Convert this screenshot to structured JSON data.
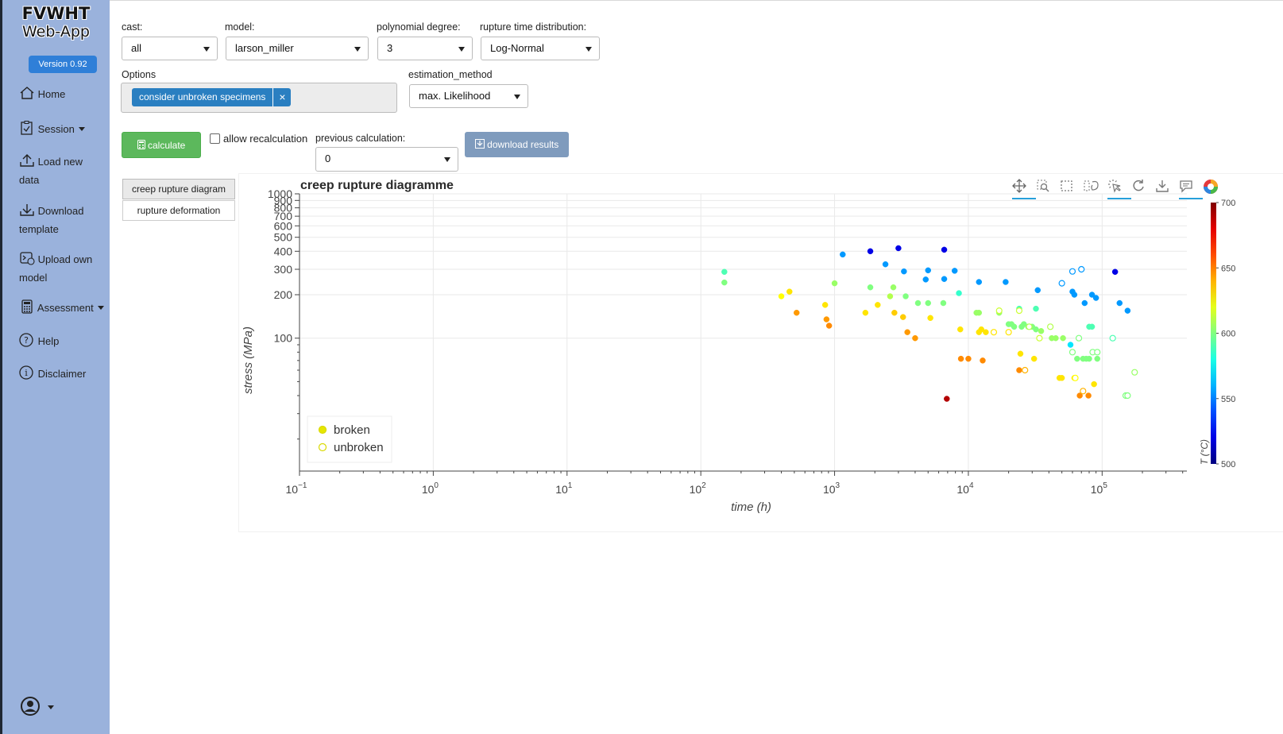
{
  "app": {
    "title": "FVWHT",
    "subtitle": "Web-App",
    "version": "Version 0.92"
  },
  "sidebar": {
    "items": [
      {
        "label": "Home",
        "icon": "home-icon"
      },
      {
        "label": "Session",
        "icon": "clipboard-check-icon",
        "dropdown": true
      },
      {
        "label": "Load new data",
        "icon": "upload-icon"
      },
      {
        "label": "Download template",
        "icon": "download-icon"
      },
      {
        "label": "Upload own model",
        "icon": "terminal-upload-icon"
      },
      {
        "label": "Assessment",
        "icon": "calculator-icon",
        "dropdown": true
      },
      {
        "label": "Help",
        "icon": "question-circle-icon"
      },
      {
        "label": "Disclaimer",
        "icon": "info-circle-icon"
      }
    ],
    "user_icon": "user-circle-icon"
  },
  "controls": {
    "cast_label": "cast:",
    "cast_value": "all",
    "model_label": "model:",
    "model_value": "larson_miller",
    "degree_label": "polynomial degree:",
    "degree_value": "3",
    "distribution_label": "rupture time distribution:",
    "distribution_value": "Log-Normal",
    "options_label": "Options",
    "options_chip": "consider unbroken specimens",
    "chip_remove": "×",
    "estimation_label": "estimation_method",
    "estimation_value": "max. Likelihood",
    "calculate_label": "calculate",
    "recalc_label": "allow recalculation",
    "previous_label": "previous calculation:",
    "previous_value": "0",
    "download_label": "download results"
  },
  "tabs": [
    {
      "label": "creep rupture diagram",
      "active": true
    },
    {
      "label": "rupture deformation",
      "active": false
    }
  ],
  "toolbar_icons": [
    "pan-icon",
    "box-zoom-icon",
    "box-select-icon",
    "lasso-select-icon",
    "tap-icon",
    "reset-icon",
    "save-icon",
    "hover-icon",
    "bokeh-logo-icon"
  ],
  "chart_data": {
    "type": "scatter",
    "title": "creep rupture diagramme",
    "xlabel": "time (h)",
    "ylabel": "stress (MPa)",
    "xscale": "log",
    "yscale": "log",
    "xlim": [
      0.1,
      430000
    ],
    "ylim": [
      12,
      1000
    ],
    "xticks": [
      0.1,
      1,
      10,
      100,
      1000,
      10000,
      100000
    ],
    "xtick_labels": [
      [
        "10",
        "−1"
      ],
      [
        "10",
        "0"
      ],
      [
        "10",
        "1"
      ],
      [
        "10",
        "2"
      ],
      [
        "10",
        "3"
      ],
      [
        "10",
        "4"
      ],
      [
        "10",
        "5"
      ]
    ],
    "yticks": [
      100,
      200,
      300,
      400,
      500,
      600,
      700,
      800,
      900,
      1000
    ],
    "ytick_labels": [
      "100",
      "200",
      "300",
      "400",
      "500",
      "600",
      "700",
      "800",
      "900",
      "1000"
    ],
    "grid": true,
    "legend": [
      {
        "label": "broken",
        "marker": "filled-circle"
      },
      {
        "label": "unbroken",
        "marker": "open-circle"
      }
    ],
    "legend_position": "bottom-left",
    "colorbar": {
      "label": "T (°C)",
      "min": 500,
      "max": 700,
      "ticks": [
        700,
        650,
        600,
        550,
        500
      ],
      "colormap": "jet"
    },
    "series": [
      {
        "name": "broken",
        "points": [
          [
            150,
            288,
            590
          ],
          [
            150,
            243,
            600
          ],
          [
            400,
            195,
            625
          ],
          [
            460,
            210,
            630
          ],
          [
            520,
            150,
            645
          ],
          [
            850,
            170,
            630
          ],
          [
            870,
            135,
            645
          ],
          [
            910,
            122,
            648
          ],
          [
            1000,
            240,
            605
          ],
          [
            1150,
            380,
            555
          ],
          [
            1700,
            150,
            630
          ],
          [
            1850,
            225,
            600
          ],
          [
            1850,
            400,
            520
          ],
          [
            2100,
            170,
            630
          ],
          [
            2400,
            325,
            555
          ],
          [
            2600,
            195,
            610
          ],
          [
            2750,
            225,
            605
          ],
          [
            2800,
            150,
            635
          ],
          [
            3000,
            420,
            520
          ],
          [
            3250,
            140,
            635
          ],
          [
            3300,
            290,
            555
          ],
          [
            3400,
            195,
            600
          ],
          [
            3500,
            110,
            645
          ],
          [
            4000,
            100,
            645
          ],
          [
            4200,
            175,
            600
          ],
          [
            4800,
            255,
            555
          ],
          [
            5000,
            175,
            600
          ],
          [
            5000,
            295,
            555
          ],
          [
            5200,
            138,
            630
          ],
          [
            6500,
            175,
            600
          ],
          [
            6600,
            257,
            555
          ],
          [
            6600,
            410,
            520
          ],
          [
            6900,
            38,
            690
          ],
          [
            7900,
            293,
            555
          ],
          [
            8500,
            205,
            585
          ],
          [
            8700,
            115,
            630
          ],
          [
            8800,
            72,
            648
          ],
          [
            10000,
            72,
            648
          ],
          [
            11500,
            150,
            605
          ],
          [
            12000,
            150,
            605
          ],
          [
            12000,
            245,
            555
          ],
          [
            12000,
            110,
            630
          ],
          [
            12500,
            115,
            630
          ],
          [
            12800,
            70,
            648
          ],
          [
            13500,
            110,
            630
          ],
          [
            17000,
            150,
            605
          ],
          [
            19000,
            245,
            555
          ],
          [
            20000,
            125,
            600
          ],
          [
            21000,
            125,
            600
          ],
          [
            22000,
            120,
            600
          ],
          [
            24000,
            160,
            590
          ],
          [
            24000,
            60,
            648
          ],
          [
            24500,
            78,
            630
          ],
          [
            25000,
            120,
            600
          ],
          [
            26000,
            125,
            600
          ],
          [
            28000,
            120,
            600
          ],
          [
            30000,
            120,
            600
          ],
          [
            31000,
            72,
            630
          ],
          [
            32000,
            160,
            590
          ],
          [
            32000,
            115,
            600
          ],
          [
            33000,
            215,
            555
          ],
          [
            35000,
            112,
            605
          ],
          [
            42000,
            100,
            605
          ],
          [
            45000,
            100,
            605
          ],
          [
            48000,
            53,
            630
          ],
          [
            50000,
            53,
            630
          ],
          [
            51000,
            100,
            605
          ],
          [
            58000,
            90,
            570
          ],
          [
            60000,
            210,
            555
          ],
          [
            62000,
            200,
            555
          ],
          [
            62000,
            53,
            630
          ],
          [
            65000,
            72,
            600
          ],
          [
            68000,
            40,
            648
          ],
          [
            72000,
            72,
            600
          ],
          [
            74000,
            175,
            555
          ],
          [
            76000,
            72,
            600
          ],
          [
            79000,
            40,
            648
          ],
          [
            80000,
            72,
            600
          ],
          [
            80000,
            120,
            590
          ],
          [
            84000,
            120,
            590
          ],
          [
            84000,
            200,
            555
          ],
          [
            87000,
            48,
            630
          ],
          [
            90000,
            190,
            555
          ],
          [
            92000,
            72,
            600
          ],
          [
            125000,
            288,
            520
          ],
          [
            135000,
            175,
            555
          ],
          [
            155000,
            155,
            555
          ]
        ]
      },
      {
        "name": "unbroken",
        "points": [
          [
            15500,
            110,
            630
          ],
          [
            17000,
            155,
            615
          ],
          [
            20000,
            110,
            630
          ],
          [
            24000,
            155,
            615
          ],
          [
            26500,
            60,
            640
          ],
          [
            28500,
            120,
            610
          ],
          [
            34000,
            100,
            615
          ],
          [
            41000,
            120,
            610
          ],
          [
            50000,
            240,
            555
          ],
          [
            60000,
            290,
            555
          ],
          [
            60000,
            80,
            600
          ],
          [
            63000,
            53,
            625
          ],
          [
            67000,
            100,
            600
          ],
          [
            70000,
            300,
            555
          ],
          [
            72000,
            43,
            640
          ],
          [
            85000,
            80,
            600
          ],
          [
            92000,
            80,
            600
          ],
          [
            120000,
            100,
            590
          ],
          [
            150000,
            40,
            600
          ],
          [
            155000,
            40,
            600
          ],
          [
            175000,
            58,
            605
          ]
        ]
      }
    ]
  }
}
